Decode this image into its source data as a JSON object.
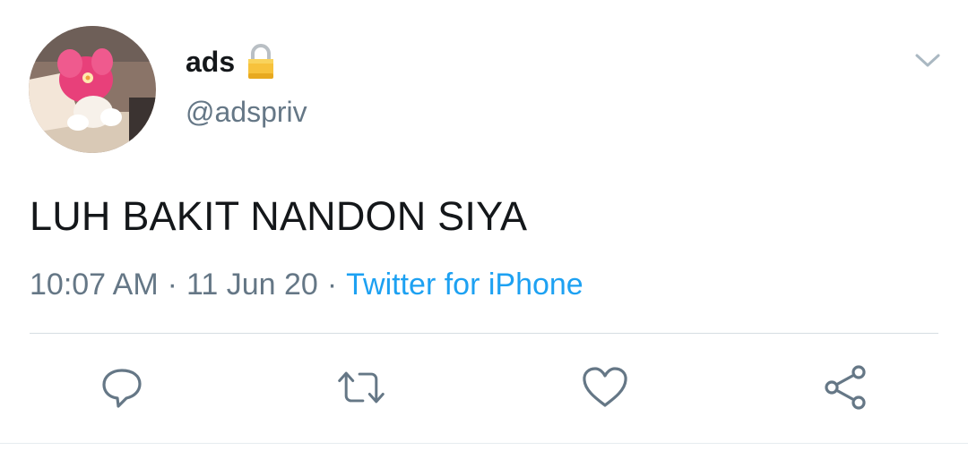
{
  "user": {
    "display_name": "ads",
    "handle": "@adspriv",
    "avatar_icon": "my-melody-avatar",
    "protected_icon": "lock-icon"
  },
  "tweet": {
    "text": "LUH BAKIT NANDON SIYA",
    "time": "10:07 AM",
    "separator": "·",
    "date": "11 Jun 20",
    "source": "Twitter for iPhone"
  },
  "actions": [
    {
      "name": "reply",
      "icon": "reply-icon"
    },
    {
      "name": "retweet",
      "icon": "retweet-icon"
    },
    {
      "name": "like",
      "icon": "heart-icon"
    },
    {
      "name": "share",
      "icon": "share-icon"
    }
  ],
  "colors": {
    "text": "#14171a",
    "secondary": "#657786",
    "link": "#1da1f2",
    "divider": "#d6dde3"
  }
}
